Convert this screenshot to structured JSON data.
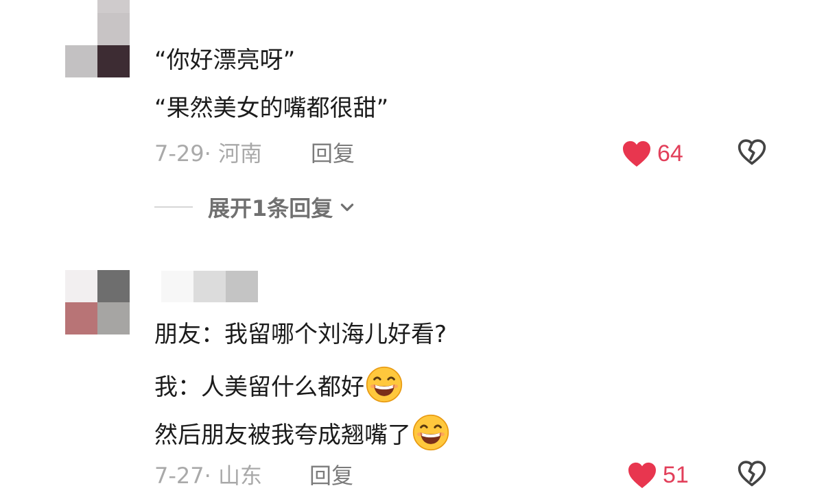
{
  "comments": [
    {
      "lines": [
        "“你好漂亮呀”",
        "“果然美女的嘴都很甜”"
      ],
      "meta": {
        "date_location": "7-29· 河南",
        "reply_label": "回复"
      },
      "likes": "64",
      "expand_replies": "展开1条回复"
    },
    {
      "lines": [
        "朋友：我留哪个刘海儿好看?",
        "我：人美留什么都好",
        "然后朋友被我夸成翘嘴了"
      ],
      "meta": {
        "date_location": "7-27· 山东",
        "reply_label": "回复"
      },
      "likes": "51"
    }
  ],
  "icons": {
    "like": "heart-icon",
    "dislike": "broken-heart-icon",
    "expand": "chevron-down-icon",
    "emoji": "grinning-face-emoji"
  },
  "colors": {
    "like_red": "#e8364f",
    "meta_gray": "#a3a3a3",
    "reply_gray": "#7b7b7b"
  }
}
